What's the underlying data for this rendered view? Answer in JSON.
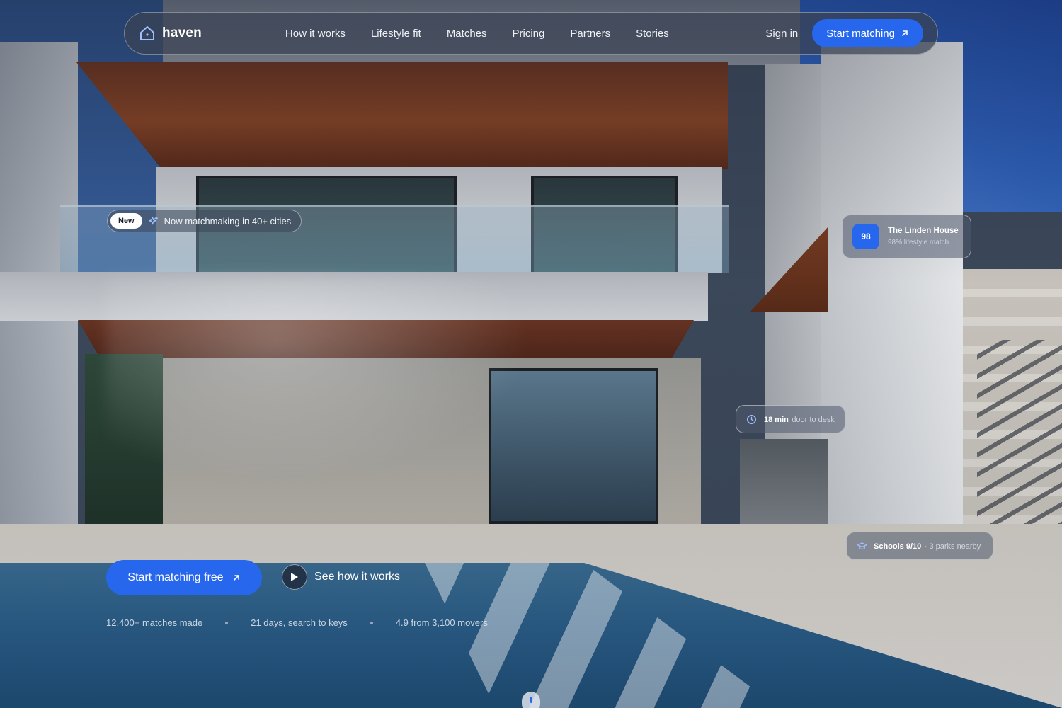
{
  "nav": {
    "brand": "haven",
    "links": [
      "How it works",
      "Lifestyle fit",
      "Matches",
      "Pricing",
      "Partners",
      "Stories"
    ],
    "sign_in": "Sign in",
    "cta": "Start matching"
  },
  "announcement": {
    "badge": "New",
    "text": "Now matchmaking in 40+ cities"
  },
  "hero": {
    "cta_primary": "Start matching free",
    "cta_secondary": "See how it works"
  },
  "stats": [
    "12,400+ matches made",
    "21 days, search to keys",
    "4.9 from 3,100 movers"
  ],
  "cards": {
    "match": {
      "score": "98",
      "title": "The Linden House",
      "subtitle": "98% lifestyle match"
    },
    "commute": {
      "strong": "18 min",
      "rest": "door to desk"
    },
    "school": {
      "strong": "Schools 9/10",
      "rest": "· 3 parks nearby"
    }
  },
  "colors": {
    "accent": "#2767ee",
    "nav_bg": "#3a4254"
  },
  "icons": {
    "brand": "house-icon",
    "nav_cta": "arrow-up-right-icon",
    "announcement": "sparkle-icon",
    "play": "play-icon",
    "commute": "clock-icon",
    "school": "graduation-cap-icon"
  }
}
